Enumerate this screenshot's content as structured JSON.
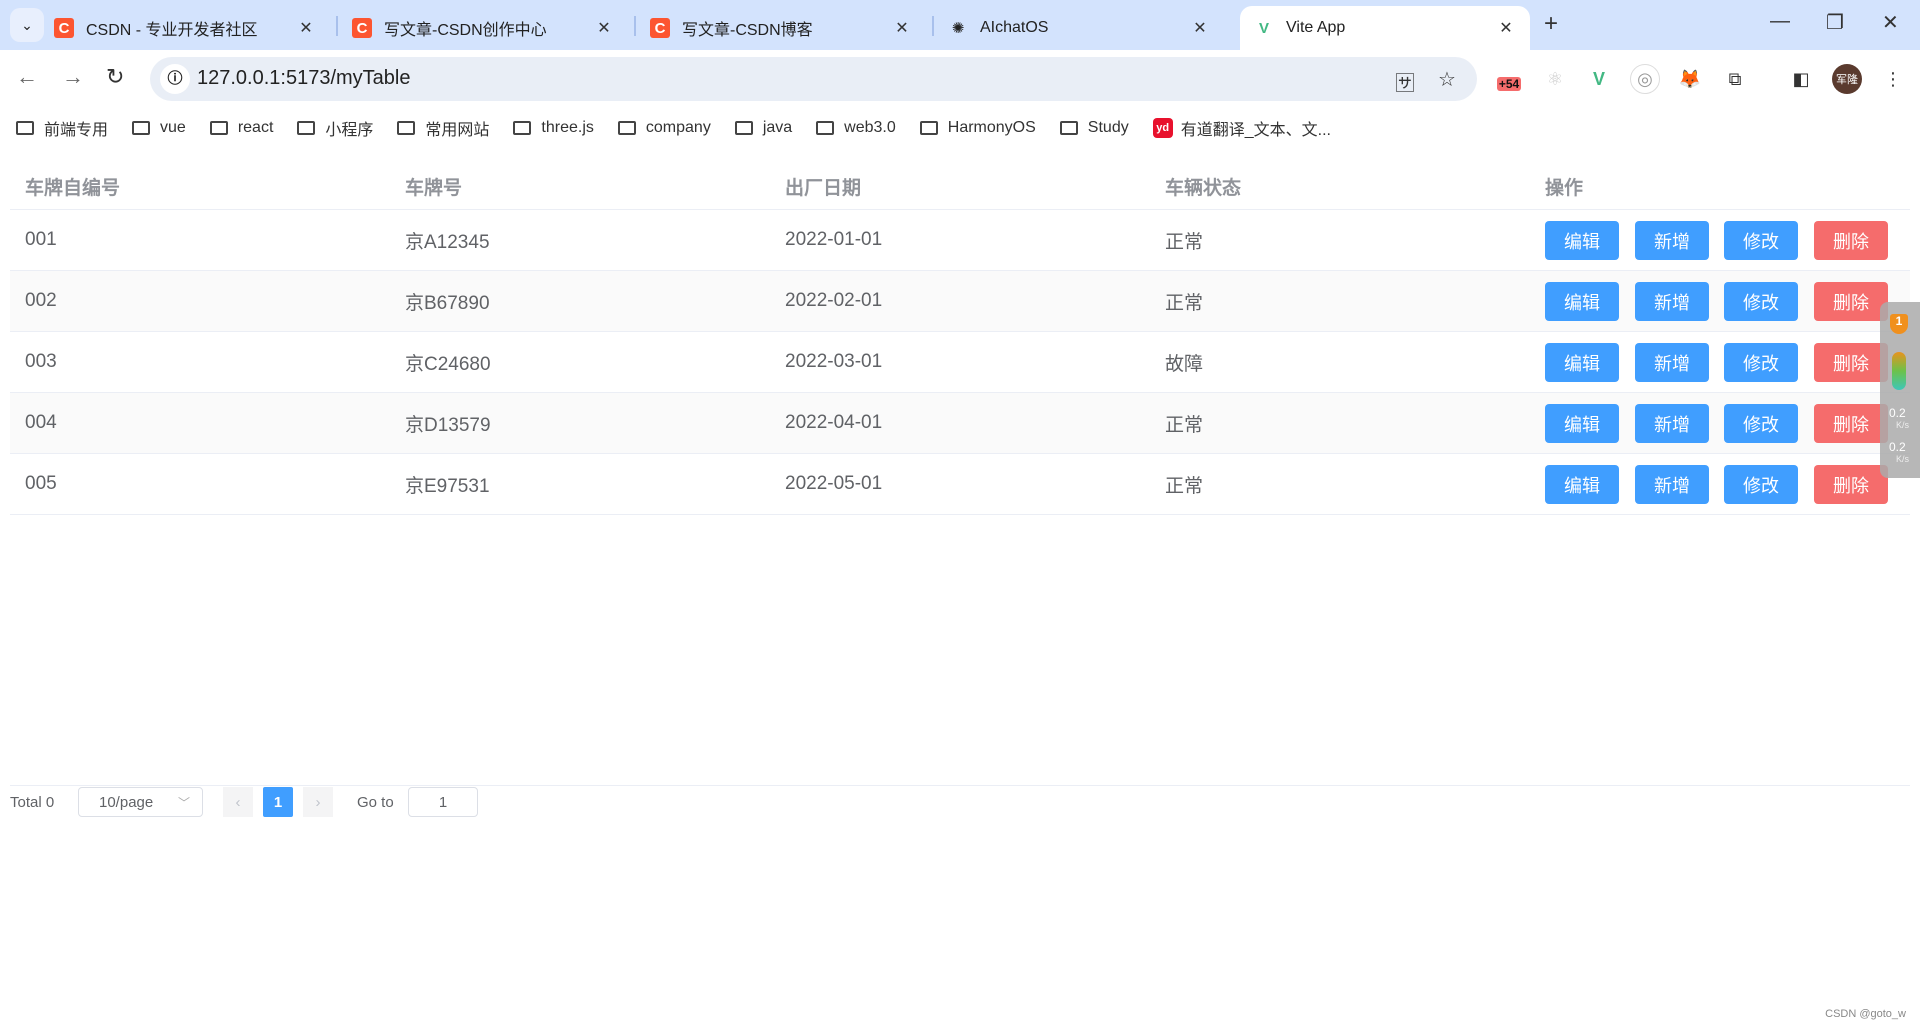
{
  "browser": {
    "tabs": [
      {
        "title": "CSDN - 专业开发者社区",
        "icon": "csdn-icon",
        "color": "#fc5531"
      },
      {
        "title": "写文章-CSDN创作中心",
        "icon": "csdn-icon",
        "color": "#fc5531"
      },
      {
        "title": "写文章-CSDN博客",
        "icon": "csdn-icon",
        "color": "#fc5531"
      },
      {
        "title": "AIchatOS",
        "icon": "openai-icon",
        "color": "#222222"
      },
      {
        "title": "Vite App",
        "icon": "vue-icon",
        "color": "#42b883",
        "active": true
      }
    ],
    "url": "127.0.0.1:5173/myTable",
    "extension_badge": "+54",
    "profile_label": "军隆",
    "bookmarks": [
      "前端专用",
      "vue",
      "react",
      "小程序",
      "常用网站",
      "three.js",
      "company",
      "java",
      "web3.0",
      "HarmonyOS",
      "Study"
    ],
    "youdao_bookmark": {
      "icon_text": "yd",
      "label": "有道翻译_文本、文..."
    }
  },
  "table": {
    "headers": [
      "车牌自编号",
      "车牌号",
      "出厂日期",
      "车辆状态",
      "操作"
    ],
    "rows": [
      [
        "001",
        "京A12345",
        "2022-01-01",
        "正常"
      ],
      [
        "002",
        "京B67890",
        "2022-02-01",
        "正常"
      ],
      [
        "003",
        "京C24680",
        "2022-03-01",
        "故障"
      ],
      [
        "004",
        "京D13579",
        "2022-04-01",
        "正常"
      ],
      [
        "005",
        "京E97531",
        "2022-05-01",
        "正常"
      ]
    ],
    "actions": [
      "编辑",
      "新增",
      "修改",
      "删除"
    ],
    "colors": {
      "primary": "#409eff",
      "danger": "#f56c6c"
    }
  },
  "pagination": {
    "total_label": "Total 0",
    "page_size": "10/page",
    "current_page": "1",
    "goto_label": "Go to",
    "goto_value": "1"
  },
  "side_widget": {
    "badge": "1",
    "up_speed": "0.2",
    "down_speed": "0.2",
    "unit": "K/s"
  },
  "watermark": "CSDN @goto_w"
}
